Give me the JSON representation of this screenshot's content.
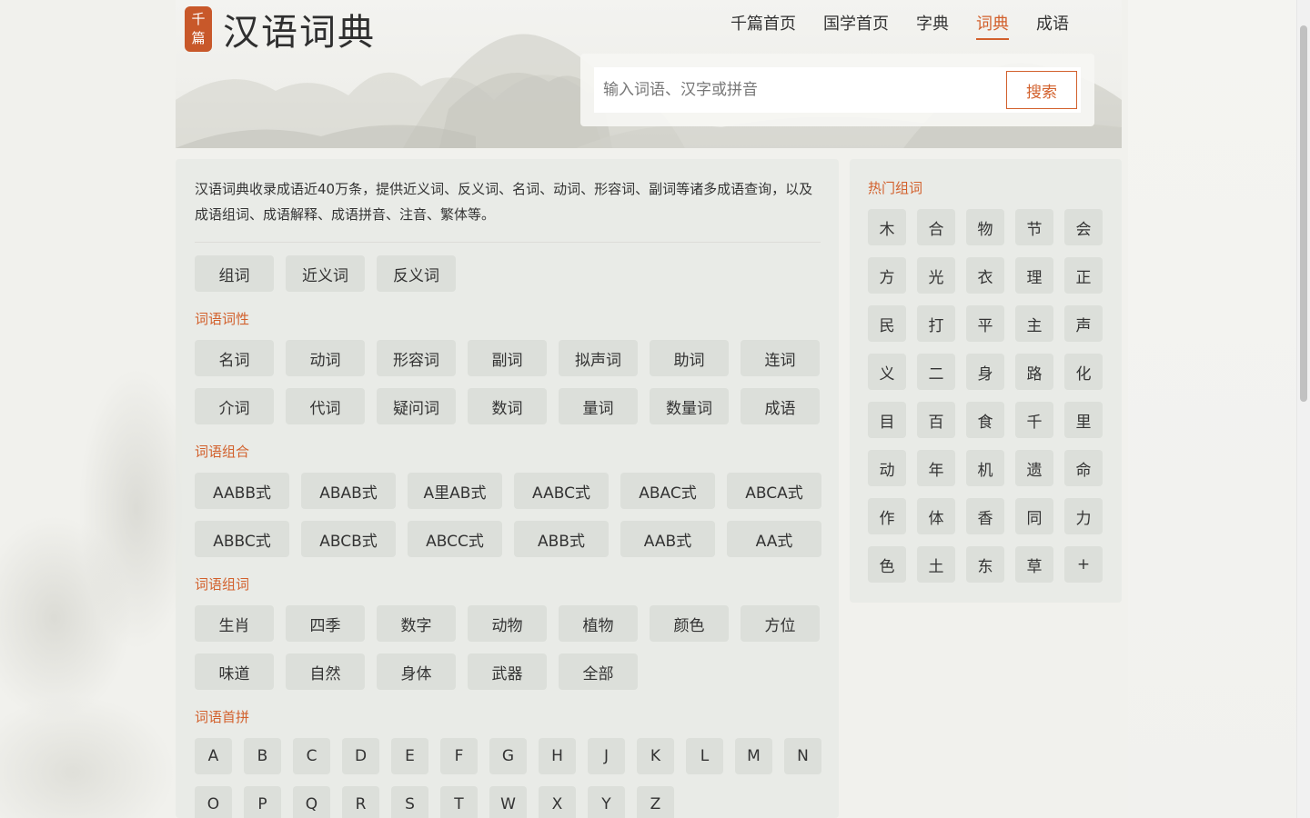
{
  "brand": {
    "seal_chars": [
      "千",
      "篇"
    ],
    "title": "汉语词典"
  },
  "nav": [
    {
      "label": "千篇首页",
      "active": false
    },
    {
      "label": "国学首页",
      "active": false
    },
    {
      "label": "字典",
      "active": false
    },
    {
      "label": "词典",
      "active": true
    },
    {
      "label": "成语",
      "active": false
    }
  ],
  "search": {
    "placeholder": "输入词语、汉字或拼音",
    "button": "搜索"
  },
  "intro": "汉语词典收录成语近40万条，提供近义词、反义词、名词、动词、形容词、副词等诸多成语查询，以及成语组词、成语解释、成语拼音、注音、繁体等。",
  "main": {
    "quick": [
      "组词",
      "近义词",
      "反义词"
    ],
    "pos_title": "词语词性",
    "pos_row1": [
      "名词",
      "动词",
      "形容词",
      "副词",
      "拟声词",
      "助词",
      "连词"
    ],
    "pos_row2": [
      "介词",
      "代词",
      "疑问词",
      "数词",
      "量词",
      "数量词",
      "成语"
    ],
    "pattern_title": "词语组合",
    "pattern_row1": [
      "AABB式",
      "ABAB式",
      "A里AB式",
      "AABC式",
      "ABAC式",
      "ABCA式"
    ],
    "pattern_row2": [
      "ABBC式",
      "ABCB式",
      "ABCC式",
      "ABB式",
      "AAB式",
      "AA式"
    ],
    "topic_title": "词语组词",
    "topic_row1": [
      "生肖",
      "四季",
      "数字",
      "动物",
      "植物",
      "颜色",
      "方位"
    ],
    "topic_row2": [
      "味道",
      "自然",
      "身体",
      "武器",
      "全部"
    ],
    "pinyin_title": "词语首拼",
    "pinyin_row1": [
      "A",
      "B",
      "C",
      "D",
      "E",
      "F",
      "G",
      "H",
      "J",
      "K",
      "L",
      "M",
      "N"
    ],
    "pinyin_row2": [
      "O",
      "P",
      "Q",
      "R",
      "S",
      "T",
      "W",
      "X",
      "Y",
      "Z"
    ]
  },
  "side": {
    "title": "热门组词",
    "chars": [
      "木",
      "合",
      "物",
      "节",
      "会",
      "方",
      "光",
      "衣",
      "理",
      "正",
      "民",
      "打",
      "平",
      "主",
      "声",
      "义",
      "二",
      "身",
      "路",
      "化",
      "目",
      "百",
      "食",
      "千",
      "里",
      "动",
      "年",
      "机",
      "遗",
      "命",
      "作",
      "体",
      "香",
      "同",
      "力",
      "色",
      "土",
      "东",
      "草",
      "+"
    ]
  },
  "colors": {
    "accent": "#d2602c",
    "chip_bg": "#dcdfda",
    "panel_bg": "#e8eae5"
  }
}
